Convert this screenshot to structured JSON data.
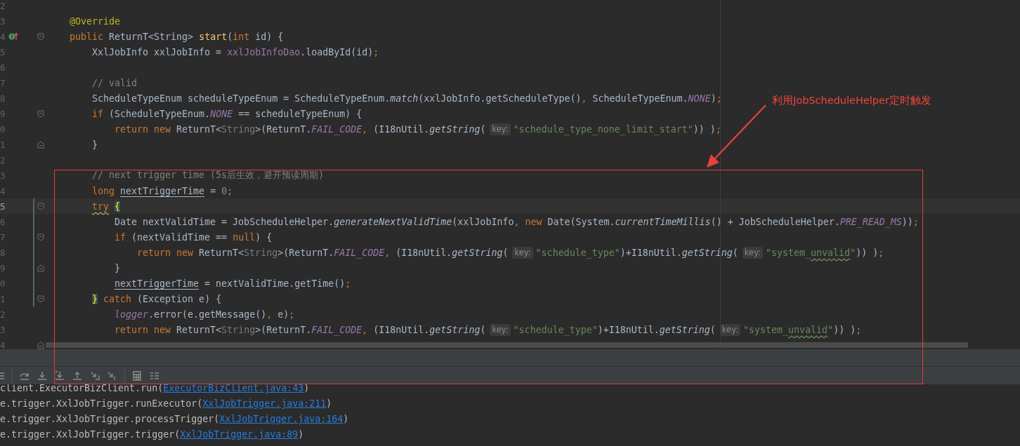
{
  "editor": {
    "lines": [
      {
        "number": "2",
        "modified": false,
        "current": false
      },
      {
        "number": "3",
        "modified": false,
        "current": false,
        "tokens": [
          {
            "kind": "annotation",
            "text": "@Override"
          }
        ]
      },
      {
        "number": "4",
        "modified": false,
        "current": false,
        "marker": true,
        "fold_start": true,
        "tokens": [
          {
            "kind": "keyword",
            "text": "public "
          },
          {
            "kind": "plain",
            "text": "ReturnT<String> "
          },
          {
            "kind": "declaration",
            "text": "start"
          },
          {
            "kind": "plain",
            "text": "("
          },
          {
            "kind": "keyword",
            "text": "int "
          },
          {
            "kind": "plain",
            "text": "id) {"
          }
        ],
        "children": [
          {
            "number": "5",
            "modified": false,
            "current": false,
            "tokens": [
              {
                "kind": "plain",
                "text": "XxlJobInfo xxlJobInfo = "
              },
              {
                "kind": "field",
                "text": "xxlJobInfoDao"
              },
              {
                "kind": "plain",
                "text": ".loadById(id)"
              },
              {
                "kind": "keyword",
                "text": ";"
              }
            ]
          },
          {
            "number": "6",
            "modified": false,
            "current": false
          },
          {
            "number": "7",
            "modified": false,
            "current": false,
            "tokens": [
              {
                "kind": "comment",
                "text": "// valid"
              }
            ]
          },
          {
            "number": "8",
            "modified": false,
            "current": false,
            "tokens": [
              {
                "kind": "plain",
                "text": "ScheduleTypeEnum scheduleTypeEnum = ScheduleTypeEnum."
              },
              {
                "kind": "staticcall",
                "text": "match"
              },
              {
                "kind": "plain",
                "text": "(xxlJobInfo.getScheduleType()"
              },
              {
                "kind": "keyword",
                "text": ", "
              },
              {
                "kind": "plain",
                "text": "ScheduleTypeEnum."
              },
              {
                "kind": "constant",
                "text": "NONE"
              },
              {
                "kind": "plain",
                "text": ")"
              },
              {
                "kind": "keyword",
                "text": ";"
              }
            ]
          },
          {
            "number": "9",
            "modified": false,
            "current": false,
            "fold_start": true,
            "tokens": [
              {
                "kind": "keyword",
                "text": "if "
              },
              {
                "kind": "plain",
                "text": "(ScheduleTypeEnum."
              },
              {
                "kind": "constant",
                "text": "NONE"
              },
              {
                "kind": "plain",
                "text": " == scheduleTypeEnum) {"
              }
            ],
            "children": [
              {
                "number": "0",
                "modified": false,
                "current": false,
                "tokens": [
                  {
                    "kind": "keyword",
                    "text": "return new "
                  },
                  {
                    "kind": "plain",
                    "text": "ReturnT<"
                  },
                  {
                    "kind": "typearg",
                    "text": "String"
                  },
                  {
                    "kind": "plain",
                    "text": ">(ReturnT."
                  },
                  {
                    "kind": "constant",
                    "text": "FAIL_CODE"
                  },
                  {
                    "kind": "keyword",
                    "text": ", "
                  },
                  {
                    "kind": "plain",
                    "text": "(I18nUtil."
                  },
                  {
                    "kind": "staticcall",
                    "text": "getString"
                  },
                  {
                    "kind": "plain",
                    "text": "("
                  },
                  {
                    "kind": "hint",
                    "text": "key:"
                  },
                  {
                    "kind": "string",
                    "text": "\"schedule_type_none_limit_start\""
                  },
                  {
                    "kind": "plain",
                    "text": ")) )"
                  },
                  {
                    "kind": "keyword",
                    "text": ";"
                  }
                ]
              }
            ]
          },
          {
            "number": "1",
            "modified": false,
            "current": false,
            "fold_end": true,
            "tokens": [
              {
                "kind": "plain",
                "text": "}"
              }
            ]
          },
          {
            "number": "2",
            "modified": false,
            "current": false
          },
          {
            "number": "3",
            "modified": false,
            "current": false,
            "tokens": [
              {
                "kind": "comment",
                "text": "// next trigger time (5s后生效，避开预读周期)"
              }
            ]
          },
          {
            "number": "4",
            "modified": false,
            "current": false,
            "tokens": [
              {
                "kind": "keyword",
                "text": "long "
              },
              {
                "kind": "usage",
                "text": "nextTriggerTime"
              },
              {
                "kind": "plain",
                "text": " = "
              },
              {
                "kind": "number",
                "text": "0"
              },
              {
                "kind": "keyword",
                "text": ";"
              }
            ]
          },
          {
            "number": "5",
            "modified": true,
            "current": true,
            "fold_start": true,
            "tokens": [
              {
                "kind": "warning",
                "text": "try"
              },
              {
                "kind": "brace",
                "text": "{"
              }
            ],
            "children": [
              {
                "number": "6",
                "modified": true,
                "current": false,
                "tokens": [
                  {
                    "kind": "plain",
                    "text": "Date nextValidTime = JobScheduleHelper."
                  },
                  {
                    "kind": "staticcall",
                    "text": "generateNextValidTime"
                  },
                  {
                    "kind": "plain",
                    "text": "(xxlJobInfo"
                  },
                  {
                    "kind": "keyword",
                    "text": ", new "
                  },
                  {
                    "kind": "plain",
                    "text": "Date(System."
                  },
                  {
                    "kind": "staticcall",
                    "text": "currentTimeMillis"
                  },
                  {
                    "kind": "plain",
                    "text": "() + JobScheduleHelper."
                  },
                  {
                    "kind": "constant",
                    "text": "PRE_READ_MS"
                  },
                  {
                    "kind": "plain",
                    "text": "))"
                  },
                  {
                    "kind": "keyword",
                    "text": ";"
                  }
                ]
              },
              {
                "number": "7",
                "modified": true,
                "current": false,
                "fold_start": true,
                "tokens": [
                  {
                    "kind": "keyword",
                    "text": "if "
                  },
                  {
                    "kind": "plain",
                    "text": "(nextValidTime == "
                  },
                  {
                    "kind": "keyword",
                    "text": "null"
                  },
                  {
                    "kind": "plain",
                    "text": ") {"
                  }
                ],
                "children": [
                  {
                    "number": "8",
                    "modified": true,
                    "current": false,
                    "tokens": [
                      {
                        "kind": "keyword",
                        "text": "return new "
                      },
                      {
                        "kind": "plain",
                        "text": "ReturnT<"
                      },
                      {
                        "kind": "typearg",
                        "text": "String"
                      },
                      {
                        "kind": "plain",
                        "text": ">(ReturnT."
                      },
                      {
                        "kind": "constant",
                        "text": "FAIL_CODE"
                      },
                      {
                        "kind": "keyword",
                        "text": ", "
                      },
                      {
                        "kind": "plain",
                        "text": "(I18nUtil."
                      },
                      {
                        "kind": "staticcall",
                        "text": "getString"
                      },
                      {
                        "kind": "plain",
                        "text": "("
                      },
                      {
                        "kind": "hint",
                        "text": "key:"
                      },
                      {
                        "kind": "string",
                        "text": "\"schedule_type\""
                      },
                      {
                        "kind": "plain",
                        "text": ")+I18nUtil."
                      },
                      {
                        "kind": "staticcall",
                        "text": "getString"
                      },
                      {
                        "kind": "plain",
                        "text": "("
                      },
                      {
                        "kind": "hint",
                        "text": "key:"
                      },
                      {
                        "kind": "string",
                        "text": "\"system_"
                      },
                      {
                        "kind": "typo",
                        "text": "unvalid"
                      },
                      {
                        "kind": "string",
                        "text": "\""
                      },
                      {
                        "kind": "plain",
                        "text": ")) )"
                      },
                      {
                        "kind": "keyword",
                        "text": ";"
                      }
                    ]
                  }
                ]
              },
              {
                "number": "9",
                "modified": true,
                "current": false,
                "fold_end": true,
                "tokens": [
                  {
                    "kind": "plain",
                    "text": "}"
                  }
                ]
              },
              {
                "number": "0",
                "modified": true,
                "current": false,
                "tokens": [
                  {
                    "kind": "usage",
                    "text": "nextTriggerTime"
                  },
                  {
                    "kind": "plain",
                    "text": " = nextValidTime.getTime()"
                  },
                  {
                    "kind": "keyword",
                    "text": ";"
                  }
                ]
              }
            ]
          },
          {
            "number": "1",
            "modified": true,
            "current": false,
            "fold_start": true,
            "tokens": [
              {
                "kind": "brace",
                "text": "}"
              },
              {
                "kind": "keyword",
                "text": " catch "
              },
              {
                "kind": "plain",
                "text": "(Exception e) {"
              }
            ],
            "children": [
              {
                "number": "2",
                "modified": false,
                "current": false,
                "tokens": [
                  {
                    "kind": "constant",
                    "text": "logger"
                  },
                  {
                    "kind": "plain",
                    "text": ".error(e.getMessage()"
                  },
                  {
                    "kind": "keyword",
                    "text": ", "
                  },
                  {
                    "kind": "plain",
                    "text": "e)"
                  },
                  {
                    "kind": "keyword",
                    "text": ";"
                  }
                ]
              },
              {
                "number": "3",
                "modified": false,
                "current": false,
                "tokens": [
                  {
                    "kind": "keyword",
                    "text": "return new "
                  },
                  {
                    "kind": "plain",
                    "text": "ReturnT<"
                  },
                  {
                    "kind": "typearg",
                    "text": "String"
                  },
                  {
                    "kind": "plain",
                    "text": ">(ReturnT."
                  },
                  {
                    "kind": "constant",
                    "text": "FAIL_CODE"
                  },
                  {
                    "kind": "keyword",
                    "text": ", "
                  },
                  {
                    "kind": "plain",
                    "text": "(I18nUtil."
                  },
                  {
                    "kind": "staticcall",
                    "text": "getString"
                  },
                  {
                    "kind": "plain",
                    "text": "("
                  },
                  {
                    "kind": "hint",
                    "text": "key:"
                  },
                  {
                    "kind": "string",
                    "text": "\"schedule_type\""
                  },
                  {
                    "kind": "plain",
                    "text": ")+I18nUtil."
                  },
                  {
                    "kind": "staticcall",
                    "text": "getString"
                  },
                  {
                    "kind": "plain",
                    "text": "("
                  },
                  {
                    "kind": "hint",
                    "text": "key:"
                  },
                  {
                    "kind": "string",
                    "text": "\"system_"
                  },
                  {
                    "kind": "typo",
                    "text": "unvalid"
                  },
                  {
                    "kind": "string",
                    "text": "\""
                  },
                  {
                    "kind": "plain",
                    "text": ")) )"
                  },
                  {
                    "kind": "keyword",
                    "text": ";"
                  }
                ]
              }
            ]
          },
          {
            "number": "4",
            "modified": false,
            "current": false,
            "fold_end": true
          }
        ]
      }
    ]
  },
  "console": {
    "lines": [
      {
        "text": "client.ExecutorBizClient.run(",
        "link": "ExecutorBizClient.java:43",
        "tail": ")"
      },
      {
        "text": "e.trigger.XxlJobTrigger.runExecutor(",
        "link": "XxlJobTrigger.java:211",
        "tail": ")"
      },
      {
        "text": "e.trigger.XxlJobTrigger.processTrigger(",
        "link": "XxlJobTrigger.java:164",
        "tail": ")"
      },
      {
        "text": "e.trigger.XxlJobTrigger.trigger(",
        "link": "XxlJobTrigger.java:89",
        "tail": ")"
      }
    ]
  },
  "annotation": {
    "text": "利用JobScheduleHelper定时触发"
  }
}
